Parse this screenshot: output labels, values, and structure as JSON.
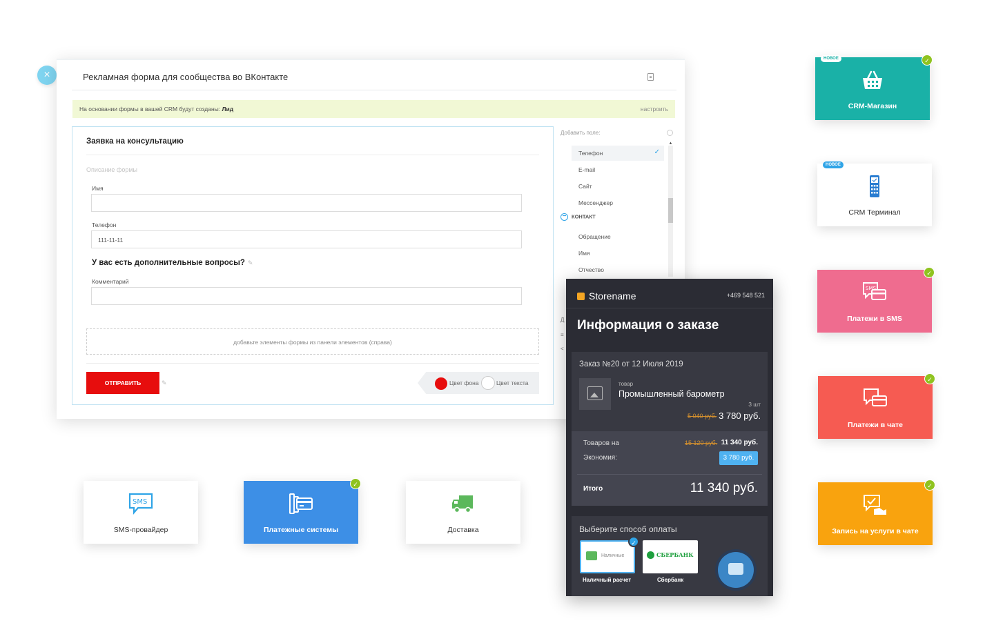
{
  "form_window": {
    "close_icon": "×",
    "title": "Рекламная форма для сообщества во ВКонтакте",
    "crm_note_prefix": "На основании формы в вашей CRM будут созданы:",
    "crm_note_entity": "Лид",
    "crm_setup_link": "настроить",
    "form_title": "Заявка на консультацию",
    "form_description_placeholder": "Описание формы",
    "fields": [
      {
        "label": "Имя",
        "value": ""
      },
      {
        "label": "Телефон",
        "value": "111-11-11"
      },
      {
        "label": "Комментарий",
        "value": ""
      }
    ],
    "question_heading": "У вас есть дополнительные вопросы?",
    "dropzone_hint": "добавьте элементы формы из панели элементов (справа)",
    "submit_label": "ОТПРАВИТЬ",
    "bg_color_label": "Цвет фона",
    "text_color_label": "Цвет текста",
    "submit_color": "#e70d0d"
  },
  "fields_panel": {
    "add_field_placeholder": "Добавить поле:",
    "items_top": [
      "Телефон",
      "E-mail",
      "Сайт",
      "Мессенджер"
    ],
    "group_label": "КОНТАКТ",
    "items_group": [
      "Обращение",
      "Имя",
      "Отчество"
    ],
    "cut_letters": [
      "Д",
      "≡",
      "<"
    ]
  },
  "store": {
    "name": "Storename",
    "phone": "+469 548 521",
    "heading": "Информация о заказе",
    "order_no": "Заказ №20 от 12 Июля 2019",
    "product_kind": "товар",
    "product_name": "Промышленный барометр",
    "quantity": "3 шт",
    "old_price": "5 040 руб.",
    "price": "3 780 руб.",
    "subtotal_label": "Товаров на",
    "subtotal_old": "15 120 руб.",
    "subtotal_value": "11 340 руб.",
    "savings_label": "Экономия:",
    "savings_value": "3 780 руб.",
    "total_label": "Итого",
    "total_value": "11 340 руб.",
    "payment_heading": "Выберите способ оплаты",
    "pay_cash_inner": "Наличные",
    "pay_cash_label": "Наличный расчет",
    "pay_sber_inner": "СБЕРБАНК",
    "pay_sber_label": "Сбербанк"
  },
  "tiles": {
    "crm_shop": {
      "label": "CRM-Магазин",
      "badge": "НОВОЕ",
      "color": "#1ab1a7"
    },
    "crm_terminal": {
      "label": "CRM Терминал",
      "badge": "НОВОЕ"
    },
    "sms_payments": {
      "label": "Платежи в SMS",
      "color": "#ef6c8f"
    },
    "chat_payments": {
      "label": "Платежи в чате",
      "color": "#f65b52"
    },
    "chat_booking": {
      "label": "Запись на услуги в чате",
      "color": "#f9a30e"
    },
    "sms_provider": {
      "label": "SMS-провайдер",
      "icon_text": "SMS"
    },
    "payment_systems": {
      "label": "Платежные системы",
      "color": "#3d8fe6"
    },
    "delivery": {
      "label": "Доставка"
    }
  }
}
